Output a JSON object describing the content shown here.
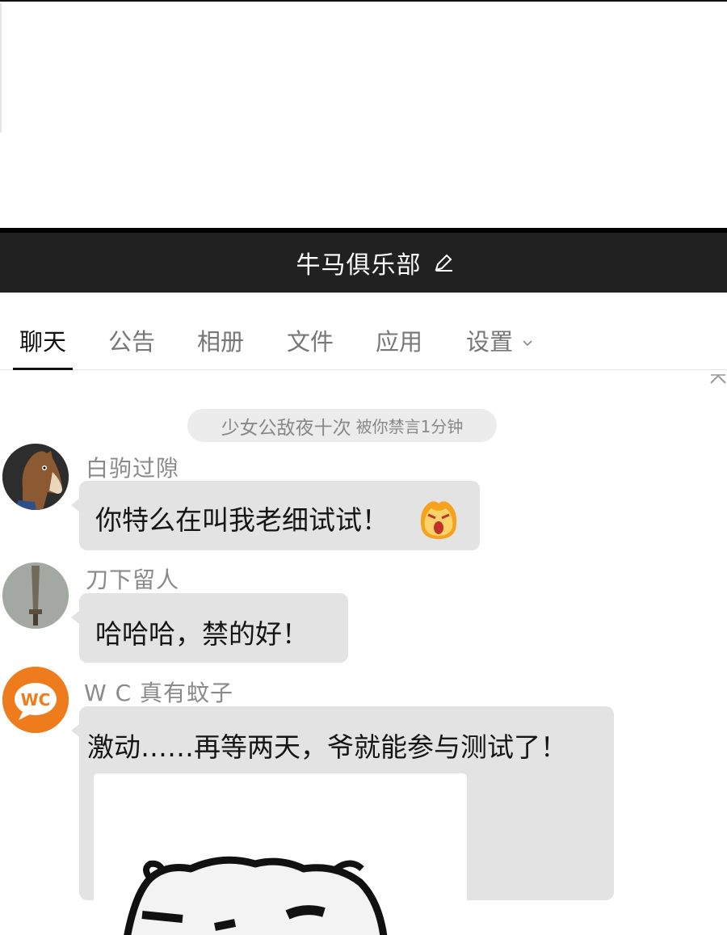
{
  "header": {
    "title": "牛马俱乐部"
  },
  "tabs": [
    {
      "label": "聊天",
      "active": true
    },
    {
      "label": "公告"
    },
    {
      "label": "相册"
    },
    {
      "label": "文件"
    },
    {
      "label": "应用"
    },
    {
      "label": "设置"
    }
  ],
  "notice": {
    "name": "少女公敌夜十次",
    "action": "被你禁言1分钟"
  },
  "messages": [
    {
      "sender": "白驹过隙",
      "text": "你特么在叫我老细试试！",
      "emoji": "angry-face-emoji",
      "avatar": "horse-avatar"
    },
    {
      "sender": "刀下留人",
      "text": "哈哈哈，禁的好！",
      "avatar": "sword-avatar"
    },
    {
      "sender": "W C 真有蚊子",
      "text": "激动……再等两天，爷就能参与测试了！",
      "avatar_text": "WC",
      "sticker": "meme-sticker"
    }
  ],
  "colors": {
    "titlebar": "#212121",
    "bubble": "#e3e3e3",
    "wc_orange": "#ee7c1c"
  }
}
